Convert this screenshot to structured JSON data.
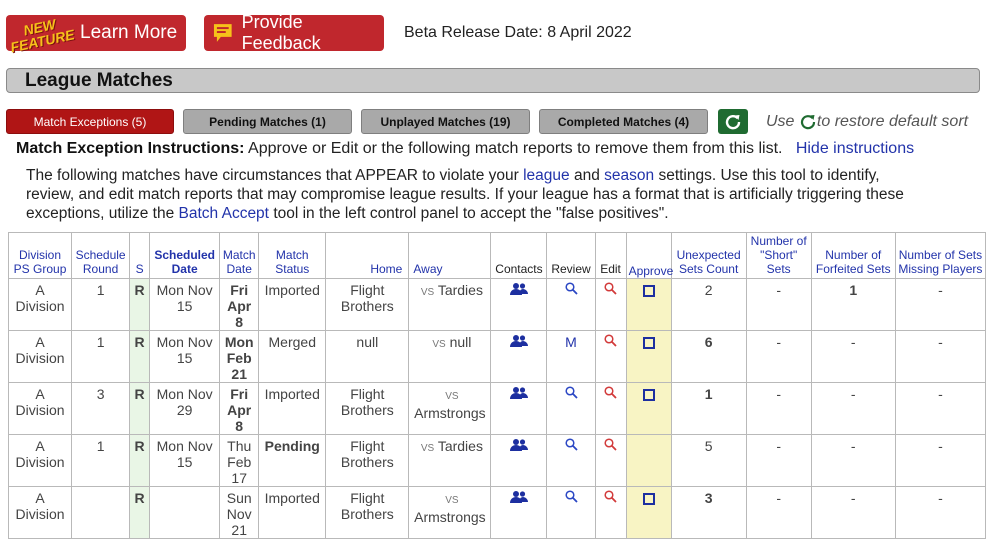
{
  "header": {
    "badge_line1": "NEW",
    "badge_line2": "FEATURE",
    "learn_more": "Learn More",
    "provide_feedback": "Provide Feedback",
    "beta_release": "Beta Release Date: 8 April 2022"
  },
  "section_title": "League Matches",
  "tabs": [
    {
      "label": "Match Exceptions (5)",
      "active": true
    },
    {
      "label": "Pending Matches (1)",
      "active": false
    },
    {
      "label": "Unplayed Matches (19)",
      "active": false
    },
    {
      "label": "Completed Matches (4)",
      "active": false
    }
  ],
  "restore_note": {
    "before": "Use",
    "after": "to restore default sort"
  },
  "instructions": {
    "title": "Match Exception Instructions:",
    "text": "Approve or Edit or the following match reports to remove them from this list.",
    "hide_link": "Hide instructions",
    "body_1": "The following matches have circumstances that APPEAR to violate your",
    "league_link": "league",
    "and": "and",
    "season_link": "season",
    "body_2": "settings. Use this tool to identify, review, and edit match reports that may compromise league results. If your league has a format that is artificially triggering these exceptions, utilize the",
    "batch_link": "Batch Accept",
    "body_3": "tool in the left control panel to accept the \"false positives\"."
  },
  "table": {
    "headers": {
      "division": "Division PS Group",
      "schedule_round": "Schedule Round",
      "s": "S",
      "scheduled_date": "Scheduled Date",
      "match_date": "Match Date",
      "match_status": "Match Status",
      "home": "Home",
      "away": "Away",
      "contacts": "Contacts",
      "review": "Review",
      "edit": "Edit",
      "approve": "Approve",
      "unexpected_sets": "Unexpected Sets Count",
      "short_sets": "Number of \"Short\" Sets",
      "forfeited_sets": "Number of Forfeited Sets",
      "missing_players": "Number of Sets Missing Players"
    },
    "vs_label": "VS",
    "rows": [
      {
        "division": "A Division",
        "round": "1",
        "s": "R",
        "scheduled": "Mon Nov 15",
        "match_date": "Fri Apr 8",
        "match_date_alert": true,
        "status": "Imported",
        "status_alert": false,
        "home": "Flight Brothers",
        "away": "Tardies",
        "review": "",
        "approve": true,
        "unexpected": "2",
        "unexpected_alert": false,
        "short": "-",
        "forfeited": "1",
        "forfeited_alert": true,
        "missing": "-"
      },
      {
        "division": "A Division",
        "round": "1",
        "s": "R",
        "scheduled": "Mon Nov 15",
        "match_date": "Mon Feb 21",
        "match_date_alert": true,
        "status": "Merged",
        "status_alert": false,
        "home": "null",
        "away": "null",
        "review": "M",
        "approve": true,
        "unexpected": "6",
        "unexpected_alert": true,
        "short": "-",
        "forfeited": "-",
        "forfeited_alert": false,
        "missing": "-"
      },
      {
        "division": "A Division",
        "round": "3",
        "s": "R",
        "scheduled": "Mon Nov 29",
        "match_date": "Fri Apr 8",
        "match_date_alert": true,
        "status": "Imported",
        "status_alert": false,
        "home": "Flight Brothers",
        "away": "Armstrongs",
        "review": "",
        "approve": true,
        "unexpected": "1",
        "unexpected_alert": true,
        "short": "-",
        "forfeited": "-",
        "forfeited_alert": false,
        "missing": "-"
      },
      {
        "division": "A Division",
        "round": "1",
        "s": "R",
        "scheduled": "Mon Nov 15",
        "match_date": "Thu Feb 17",
        "match_date_alert": false,
        "status": "Pending",
        "status_alert": true,
        "home": "Flight Brothers",
        "away": "Tardies",
        "review": "",
        "approve": false,
        "unexpected": "5",
        "unexpected_alert": false,
        "short": "-",
        "forfeited": "-",
        "forfeited_alert": false,
        "missing": "-"
      },
      {
        "division": "A Division",
        "round": "",
        "s": "R",
        "scheduled": "",
        "match_date": "Sun Nov 21",
        "match_date_alert": false,
        "status": "Imported",
        "status_alert": false,
        "home": "Flight Brothers",
        "away": "Armstrongs",
        "review": "",
        "approve": true,
        "unexpected": "3",
        "unexpected_alert": true,
        "short": "-",
        "forfeited": "-",
        "forfeited_alert": false,
        "missing": "-"
      }
    ]
  },
  "colors": {
    "brand_red": "#c0272d",
    "active_tab": "#b01515",
    "reset_green": "#1f6b31",
    "link_blue": "#2233aa",
    "alert_red": "#c22020"
  }
}
